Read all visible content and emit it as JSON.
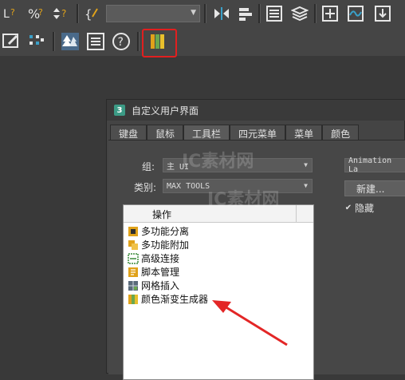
{
  "toolbar": {
    "row1_icons": [
      "link-icon",
      "percent-snap-icon",
      "spinner-snap-icon",
      "named-selection-icon",
      "mirror-icon",
      "align-icon",
      "layer-explorer-icon",
      "layers-icon",
      "curve-editor-icon",
      "schematic-view-icon",
      "material-editor-icon"
    ],
    "row2_icons": [
      "render-setup-icon",
      "grid-icon",
      "forest-pack-icon",
      "script-list-icon",
      "help-icon",
      "color-gradient-icon"
    ],
    "combo_value": ""
  },
  "dialog": {
    "title": "自定义用户界面",
    "tabs": [
      "键盘",
      "鼠标",
      "工具栏",
      "四元菜单",
      "菜单",
      "颜色"
    ],
    "active_tab": "工具栏",
    "group_label": "组:",
    "group_value": "主 UI",
    "category_label": "类别:",
    "category_value": "MAX TOOLS",
    "toolbar_select_value": "Animation La",
    "new_button": "新建...",
    "hide_checkbox_label": "隐藏",
    "hide_checked": true,
    "actions_header": "操作",
    "actions": [
      {
        "label": "多功能分离",
        "icon": "multi-detach-icon"
      },
      {
        "label": "多功能附加",
        "icon": "multi-attach-icon"
      },
      {
        "label": "高级连接",
        "icon": "advanced-connect-icon"
      },
      {
        "label": "脚本管理",
        "icon": "script-manager-icon"
      },
      {
        "label": "网格插入",
        "icon": "grid-insert-icon"
      },
      {
        "label": "颜色渐变生成器",
        "icon": "color-gradient-generator-icon"
      }
    ]
  },
  "watermark": {
    "text1": "IC素材网",
    "text2": "IC素材网"
  },
  "colors": {
    "highlight": "#e11f1f",
    "arrow": "#e32626",
    "gradient_icon": [
      "#e0a21a",
      "#6aa84f",
      "#e8c02c"
    ]
  }
}
